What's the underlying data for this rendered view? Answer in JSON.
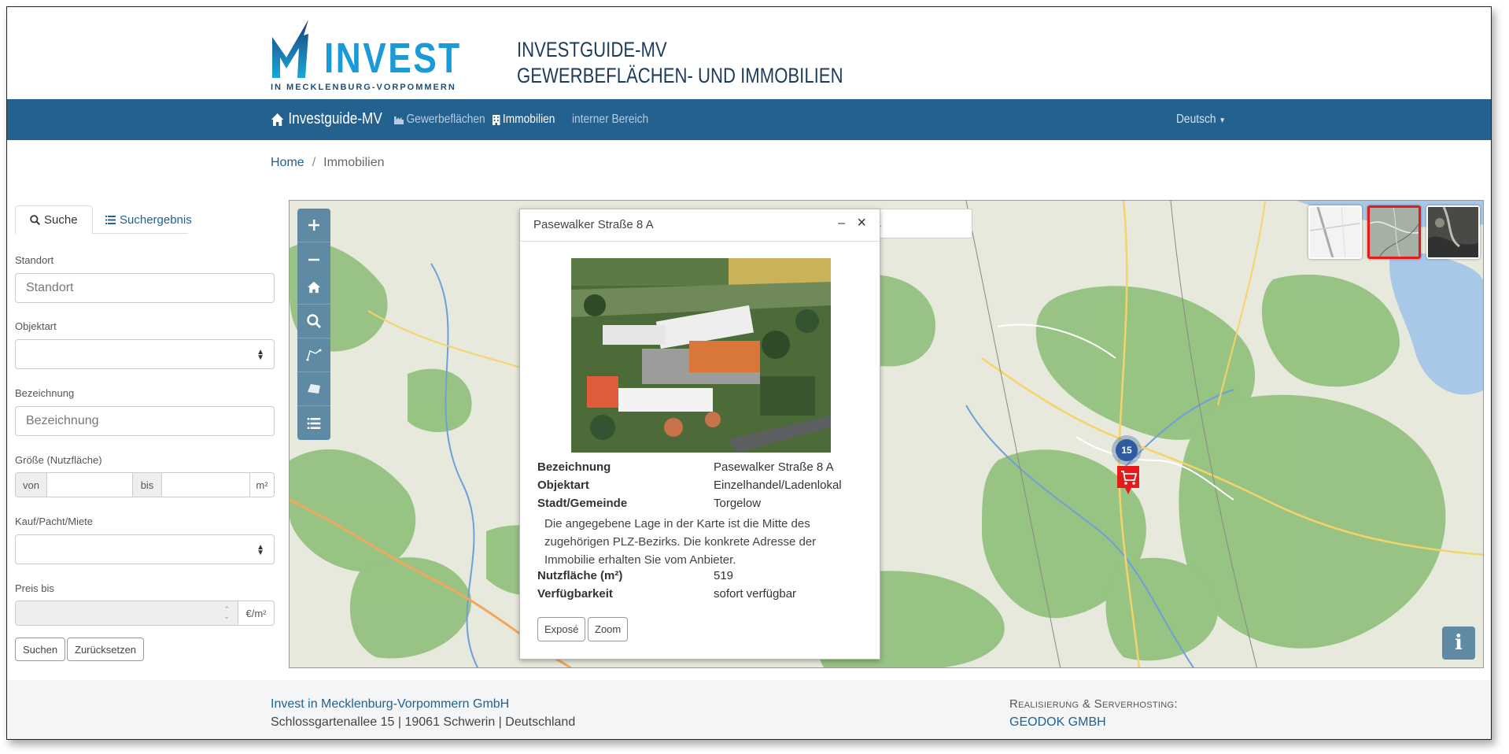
{
  "header": {
    "logo_text": "INVEST",
    "logo_sub": "IN MECKLENBURG-VORPOMMERN",
    "title_line1": "INVESTGUIDE-MV",
    "title_line2": "GEWERBEFLÄCHEN- UND IMMOBILIEN"
  },
  "nav": {
    "brand": "Investguide-MV",
    "items": [
      {
        "label": "Gewerbeflächen",
        "icon": "industry-icon"
      },
      {
        "label": "Immobilien",
        "icon": "building-icon"
      },
      {
        "label": "interner Bereich",
        "icon": ""
      }
    ],
    "language": "Deutsch"
  },
  "breadcrumb": {
    "home": "Home",
    "sep": "/",
    "current": "Immobilien"
  },
  "sidebar": {
    "tabs": [
      {
        "label": "Suche",
        "icon": "search-icon"
      },
      {
        "label": "Suchergebnis",
        "icon": "list-icon"
      }
    ],
    "standort_label": "Standort",
    "standort_placeholder": "Standort",
    "objektart_label": "Objektart",
    "objektart_value": "",
    "bezeichnung_label": "Bezeichnung",
    "bezeichnung_placeholder": "Bezeichnung",
    "groesse_label": "Größe (Nutzfläche)",
    "von": "von",
    "bis": "bis",
    "unit_m2": "m²",
    "kauf_label": "Kauf/Pacht/Miete",
    "kauf_value": "",
    "preis_label": "Preis bis",
    "preis_unit": "€/m²",
    "search_button": "Suchen",
    "reset_button": "Zurücksetzen"
  },
  "map": {
    "search_text": "..",
    "cluster_count": "15",
    "info_label": "i",
    "layers": [
      "map-layer",
      "topo-layer",
      "satellite-layer"
    ],
    "selected_layer": "topo-layer"
  },
  "popup": {
    "title": "Pasewalker Straße 8 A",
    "minimize": "–",
    "close": "×",
    "rows": [
      {
        "key": "Bezeichnung",
        "value": "Pasewalker Straße 8 A"
      },
      {
        "key": "Objektart",
        "value": "Einzelhandel/Ladenlokal"
      },
      {
        "key": "Stadt/Gemeinde",
        "value": "Torgelow"
      }
    ],
    "description": "Die angegebene Lage in der Karte ist die Mitte des zugehörigen PLZ-Bezirks. Die konkrete Adresse der Immobilie erhalten Sie vom Anbieter.",
    "rows2": [
      {
        "key": "Nutzfläche (m²)",
        "value": "519"
      },
      {
        "key": "Verfügbarkeit",
        "value": "sofort verfügbar"
      }
    ],
    "btn_expose": "Exposé",
    "btn_zoom": "Zoom"
  },
  "footer": {
    "company": "Invest in Mecklenburg-Vorpommern GmbH",
    "address": "Schlossgartenallee 15 | 19061 Schwerin | Deutschland",
    "credit_label": "Realisierung & Serverhosting:",
    "credit_company": "GEODOK GMBH"
  },
  "colors": {
    "navbar": "#23618e",
    "map_control": "#5f8aa4",
    "accent_red": "#e31b1b",
    "cluster": "#2e5aa0"
  }
}
